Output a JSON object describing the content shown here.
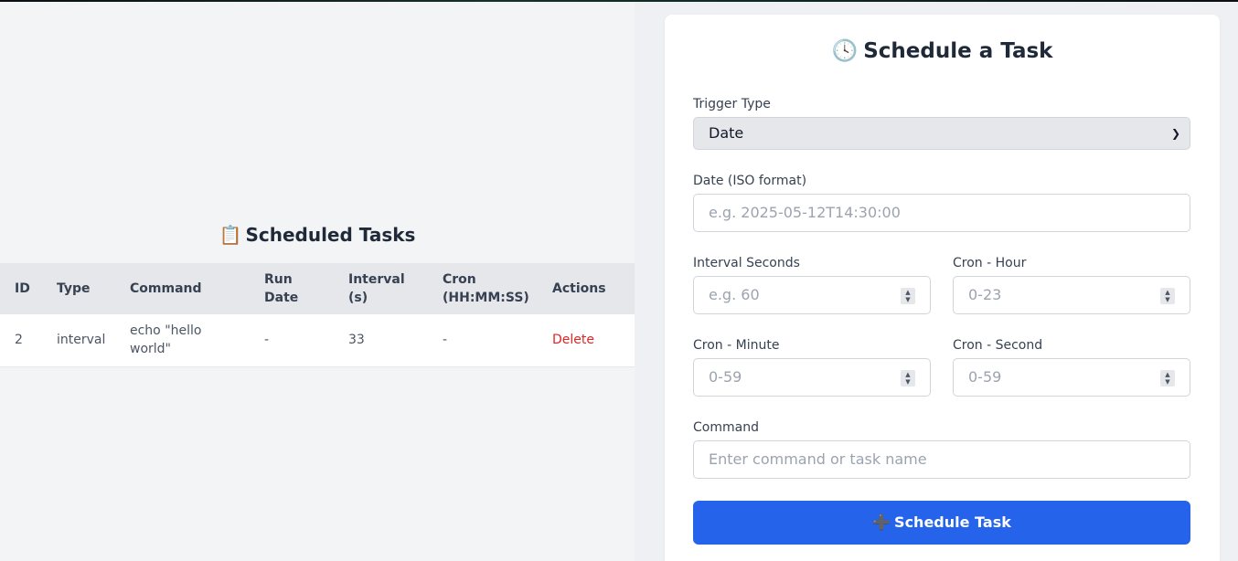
{
  "tasks_panel": {
    "icon": "📋",
    "title": "Scheduled Tasks",
    "columns": {
      "id": "ID",
      "type": "Type",
      "command": "Command",
      "run_date_1": "Run",
      "run_date_2": "Date",
      "interval_1": "Interval",
      "interval_2": "(s)",
      "cron_1": "Cron",
      "cron_2": "(HH:MM:SS)",
      "actions": "Actions"
    },
    "rows": [
      {
        "id": "2",
        "type": "interval",
        "command_1": "echo \"hello",
        "command_2": "world\"",
        "run_date": "-",
        "interval": "33",
        "cron": "-",
        "action": "Delete"
      }
    ]
  },
  "form": {
    "icon": "🕓",
    "title": "Schedule a Task",
    "trigger_type": {
      "label": "Trigger Type",
      "value": "Date"
    },
    "date": {
      "label": "Date (ISO format)",
      "placeholder": "e.g. 2025-05-12T14:30:00"
    },
    "interval_seconds": {
      "label": "Interval Seconds",
      "placeholder": "e.g. 60"
    },
    "cron_hour": {
      "label": "Cron - Hour",
      "placeholder": "0-23"
    },
    "cron_minute": {
      "label": "Cron - Minute",
      "placeholder": "0-59"
    },
    "cron_second": {
      "label": "Cron - Second",
      "placeholder": "0-59"
    },
    "command": {
      "label": "Command",
      "placeholder": "Enter command or task name"
    },
    "submit": {
      "icon": "➕",
      "label": "Schedule Task"
    }
  },
  "colors": {
    "primary": "#2563eb",
    "danger": "#dc2626",
    "background": "#f3f4f6"
  }
}
